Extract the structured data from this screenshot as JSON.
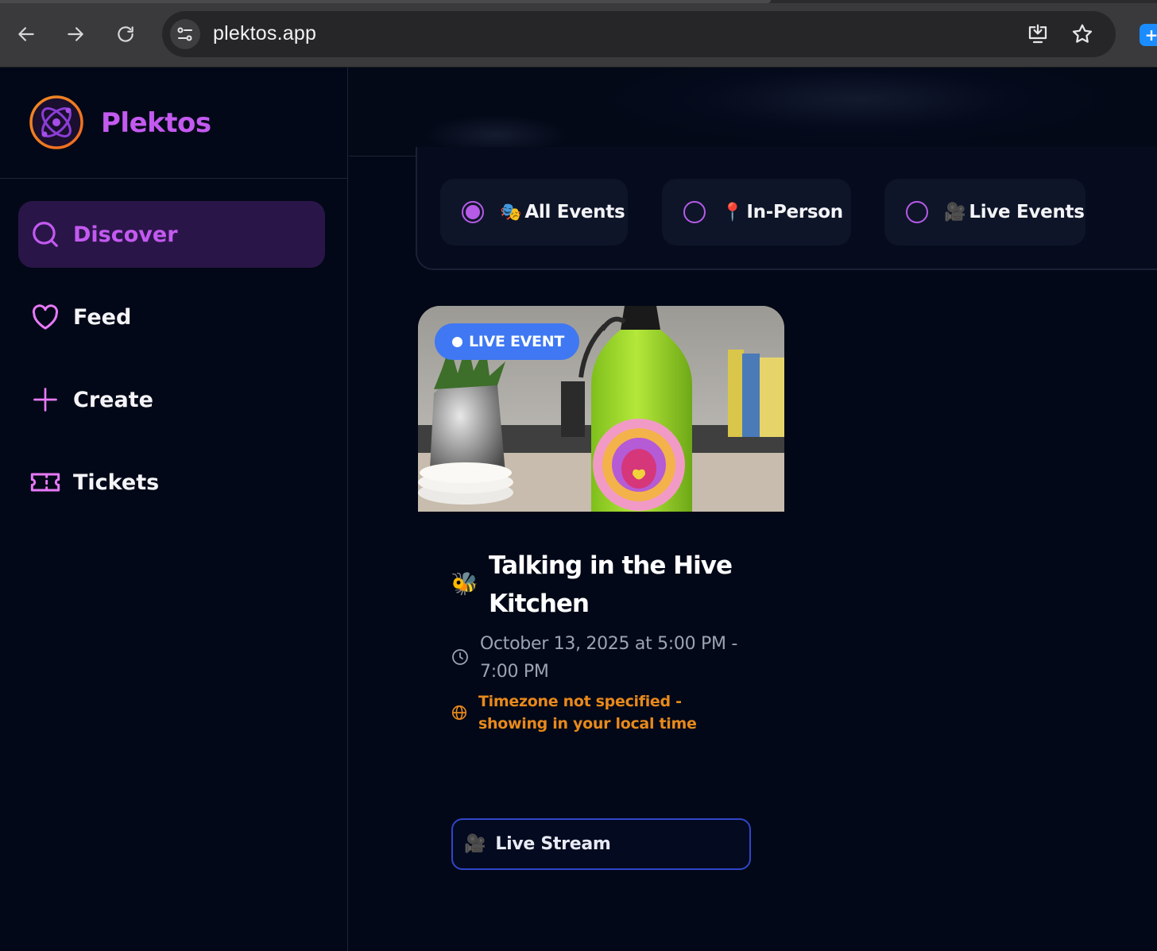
{
  "browser": {
    "url": "plektos.app"
  },
  "brand": {
    "name": "Plektos"
  },
  "sidebar": {
    "items": [
      {
        "label": "Discover",
        "icon": "search-icon",
        "active": true
      },
      {
        "label": "Feed",
        "icon": "heart-icon",
        "active": false
      },
      {
        "label": "Create",
        "icon": "plus-icon",
        "active": false
      },
      {
        "label": "Tickets",
        "icon": "ticket-icon",
        "active": false
      }
    ]
  },
  "filters": {
    "options": [
      {
        "emoji": "🎭",
        "label": "All Events",
        "selected": true
      },
      {
        "emoji": "📍",
        "label": "In-Person",
        "selected": false
      },
      {
        "emoji": "🎥",
        "label": "Live Events",
        "selected": false
      }
    ]
  },
  "event": {
    "badge": "LIVE EVENT",
    "emoji": "🐝",
    "title": "Talking in the Hive Kitchen",
    "date": "October 13, 2025 at 5:00 PM - 7:00 PM",
    "timezone_note": "Timezone not specified - showing in your local time",
    "action_emoji": "🎥",
    "action_label": "Live Stream"
  },
  "colors": {
    "accent": "#c35af0",
    "active_bg": "#2a1549",
    "badge": "#3f78f2",
    "warning": "#e8891b",
    "background": "#020817"
  }
}
